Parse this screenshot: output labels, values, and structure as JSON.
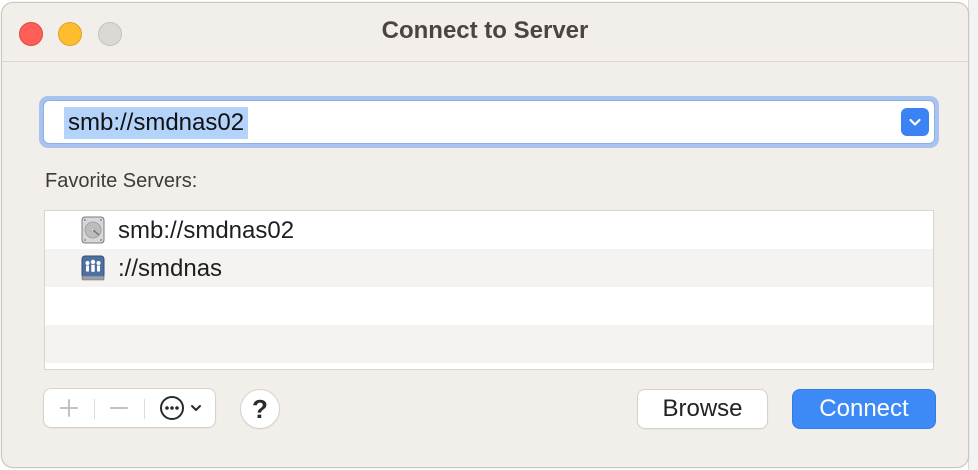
{
  "window": {
    "title": "Connect to Server"
  },
  "address": {
    "value": "smb://smdnas02",
    "dropdown_icon": "chevron-down-icon"
  },
  "favorites": {
    "label": "Favorite Servers:",
    "items": [
      {
        "label": "smb://smdnas02",
        "icon": "hard-drive-icon"
      },
      {
        "label": "://smdnas",
        "icon": "network-server-icon"
      }
    ]
  },
  "toolbar": {
    "add_icon": "plus-icon",
    "remove_icon": "minus-icon",
    "more_icon": "ellipsis-circle-icon",
    "help_label": "?"
  },
  "buttons": {
    "browse_label": "Browse",
    "connect_label": "Connect"
  },
  "colors": {
    "accent": "#3d8af7",
    "close": "#ff5f57",
    "minimize": "#febc2e",
    "zoom_inactive": "#dcd8d4"
  }
}
